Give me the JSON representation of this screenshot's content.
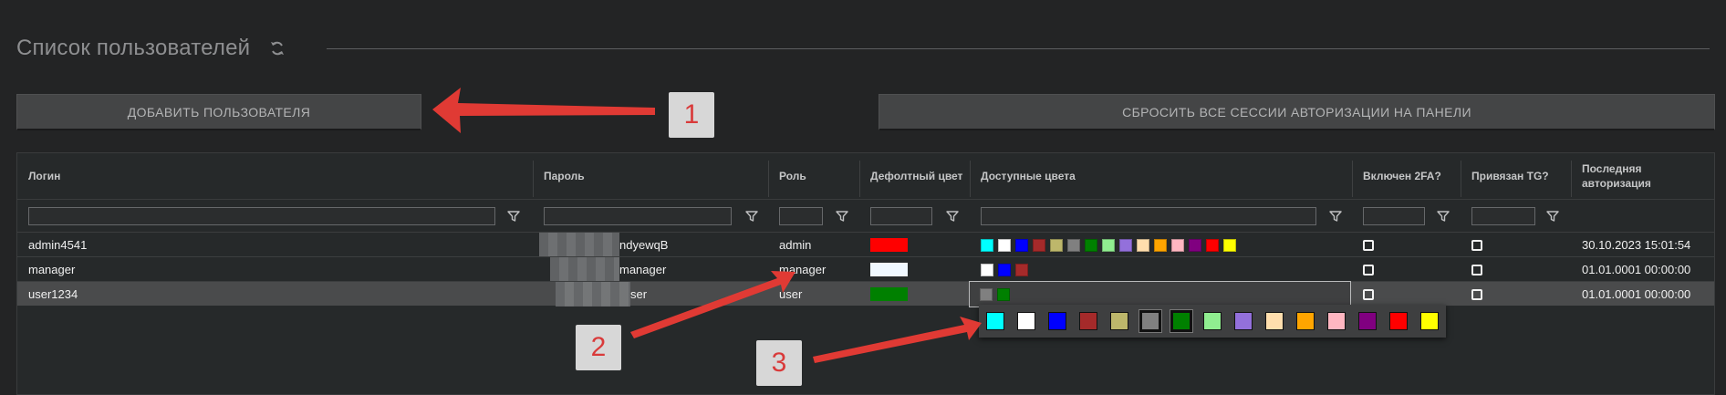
{
  "header": {
    "title": "Список пользователей",
    "refresh_icon": "refresh-icon"
  },
  "buttons": {
    "add_user": "ДОБАВИТЬ ПОЛЬЗОВАТЕЛЯ",
    "reset_sessions": "СБРОСИТЬ ВСЕ СЕССИИ АВТОРИЗАЦИИ НА ПАНЕЛИ"
  },
  "table": {
    "columns": [
      "Логин",
      "Пароль",
      "Роль",
      "Дефолтный цвет",
      "Доступные цвета",
      "Включен 2FA?",
      "Привязан TG?",
      "Последняя авторизация"
    ],
    "filter_icon": "filter-icon",
    "rows": [
      {
        "login": "admin4541",
        "password_visible": "ndyewqB",
        "role": "admin",
        "default_color": "#ff0000",
        "colors": [
          "#00ffff",
          "#ffffff",
          "#0000ff",
          "#a52a2a",
          "#bdb76b",
          "#808080",
          "#008000",
          "#90ee90",
          "#9370db",
          "#ffdead",
          "#ffa500",
          "#ffb6c1",
          "#800080",
          "#ff0000",
          "#ffff00"
        ],
        "twofa": "checkbox-empty",
        "tg": "checkbox-empty",
        "last_auth": "30.10.2023 15:01:54",
        "selected": false
      },
      {
        "login": "manager",
        "password_visible": "manager",
        "role": "manager",
        "default_color": "#f0f8ff",
        "colors": [
          "#ffffff",
          "#0000ff",
          "#a52a2a"
        ],
        "twofa": "checkbox-empty",
        "tg": "checkbox-empty",
        "last_auth": "01.01.0001 00:00:00",
        "selected": false
      },
      {
        "login": "user1234",
        "password_visible": "ser",
        "role": "user",
        "default_color": "#008000",
        "colors": [
          "#808080",
          "#008000"
        ],
        "twofa": "checkbox-empty",
        "tg": "checkbox-empty",
        "last_auth": "01.01.0001 00:00:00",
        "selected": true
      }
    ]
  },
  "palette": {
    "colors": [
      "#00ffff",
      "#ffffff",
      "#0000ff",
      "#a52a2a",
      "#bdb76b",
      "#808080",
      "#008000",
      "#90ee90",
      "#9370db",
      "#ffdead",
      "#ffa500",
      "#ffb6c1",
      "#800080",
      "#ff0000",
      "#ffff00"
    ],
    "active": [
      "#808080",
      "#008000"
    ]
  },
  "annotations": {
    "callout_1": "1",
    "callout_2": "2",
    "callout_3": "3",
    "arrow_color": "#e03a34"
  }
}
